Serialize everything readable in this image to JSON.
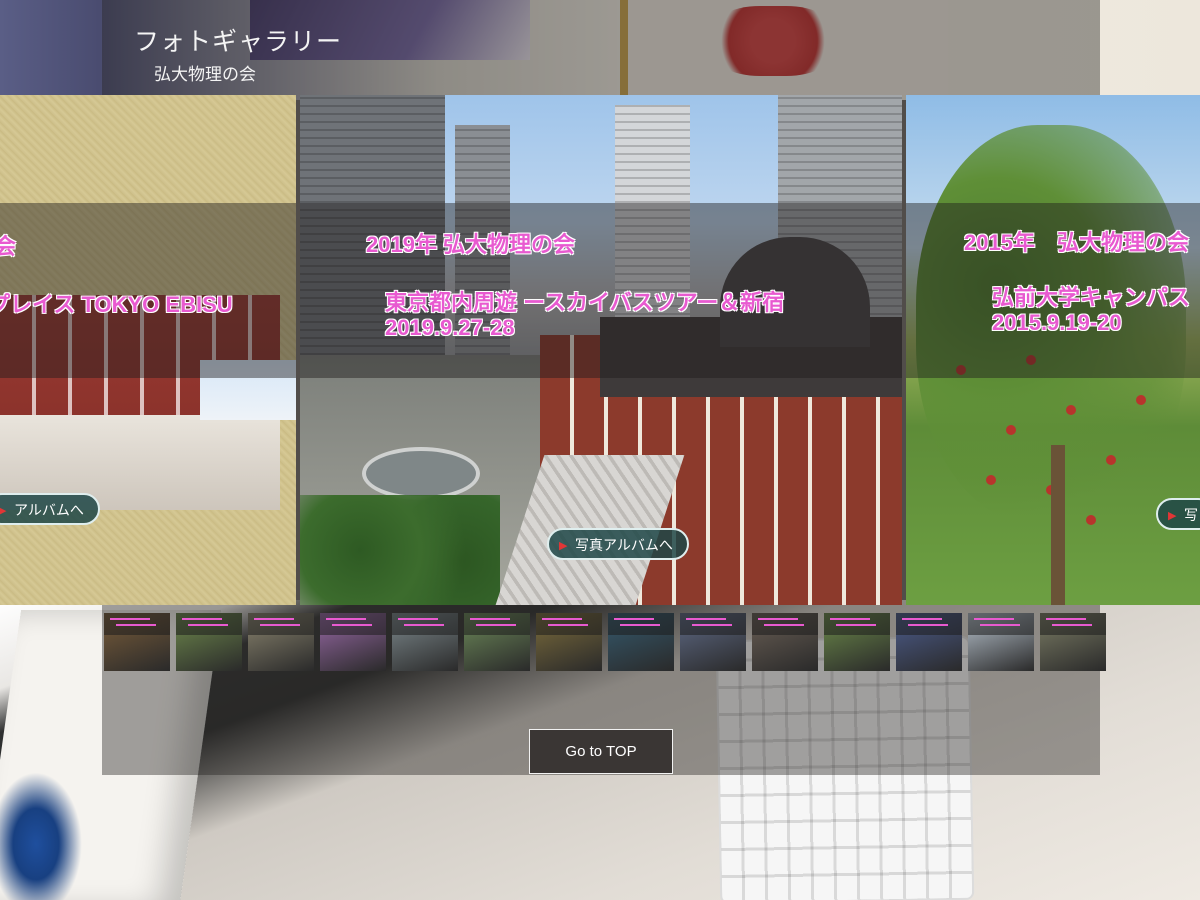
{
  "header": {
    "title": "フォトギャラリー",
    "subtitle": "弘大物理の会"
  },
  "slides": [
    {
      "id": "left",
      "line1": "会",
      "line2": "プレイス TOKYO EBISU",
      "button": "アルバムへ"
    },
    {
      "id": "center",
      "line1": "2019年 弘大物理の会",
      "line2": "東京都内周遊 ースカイバスツアー＆新宿",
      "line3": "2019.9.27-28",
      "button": "写真アルバムへ"
    },
    {
      "id": "right",
      "line1": "2015年　弘大物理の会",
      "line2": "弘前大学キャンパス",
      "line3": "2015.9.19-20",
      "button": "写"
    }
  ],
  "thumbnails": [
    {
      "color": "#7a5d3a"
    },
    {
      "color": "#6f8a4d"
    },
    {
      "color": "#8c8670"
    },
    {
      "color": "#9a6aa8"
    },
    {
      "color": "#7e8a8e"
    },
    {
      "color": "#6e8b5a"
    },
    {
      "color": "#7d6d3c"
    },
    {
      "color": "#355a6e"
    },
    {
      "color": "#5f6a86"
    },
    {
      "color": "#6a5f55"
    },
    {
      "color": "#6c8a4a"
    },
    {
      "color": "#4d5d8e"
    },
    {
      "color": "#b9c4cf"
    },
    {
      "color": "#7d7e66"
    }
  ],
  "footer": {
    "go_top": "Go to TOP"
  }
}
